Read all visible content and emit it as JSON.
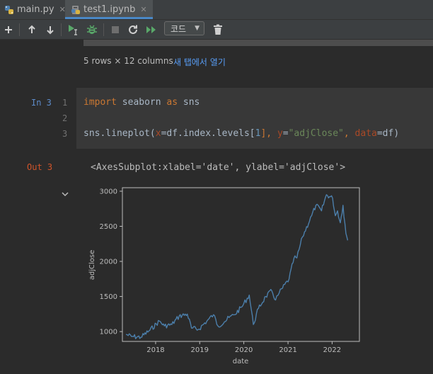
{
  "tabs": [
    {
      "label": "main.py",
      "icon": "python-file-icon",
      "active": false
    },
    {
      "label": "test1.ipynb",
      "icon": "notebook-file-icon",
      "active": true
    }
  ],
  "toolbar": {
    "cell_type": "코드"
  },
  "output_info": {
    "rows_text": "5 rows × 12 columns",
    "open_link": "새 탭에서 열기"
  },
  "cell": {
    "in_prompt": "In 3",
    "out_prompt": "Out 3",
    "line_numbers": [
      "1",
      "2",
      "3"
    ],
    "line1": {
      "t1": "import",
      "t2": " seaborn ",
      "t3": "as",
      "t4": " sns"
    },
    "line3": {
      "p1": "sns.lineplot(",
      "p2": "x",
      "p3": "=df.index.levels[",
      "p4": "1",
      "p5": "], ",
      "p6": "y",
      "p7": "=",
      "p8": "\"adjClose\"",
      "p9": ", ",
      "p10": "data",
      "p11": "=df)"
    },
    "output_text": "<AxesSubplot:xlabel='date', ylabel='adjClose'>"
  },
  "colors": {
    "line": "#4c7fab",
    "accent": "#4a88c7"
  },
  "chart_data": {
    "type": "line",
    "xlabel": "date",
    "ylabel": "adjClose",
    "x_ticks": [
      "2018",
      "2019",
      "2020",
      "2021",
      "2022"
    ],
    "y_ticks": [
      "1000",
      "1500",
      "2000",
      "2500",
      "3000"
    ],
    "xlim": [
      "2017-04-01",
      "2022-08-15"
    ],
    "ylim": [
      860,
      3050
    ],
    "grid": false,
    "series": [
      {
        "x": [
          "2017-05-01",
          "2017-06-15",
          "2017-09-01",
          "2017-11-15",
          "2018-02-01",
          "2018-03-15",
          "2018-05-15",
          "2018-07-15",
          "2018-09-20",
          "2018-10-25",
          "2018-12-20",
          "2019-03-01",
          "2019-04-25",
          "2019-06-01",
          "2019-07-25",
          "2019-09-01",
          "2019-10-15",
          "2019-12-15",
          "2020-02-15",
          "2020-03-20",
          "2020-05-01",
          "2020-07-01",
          "2020-08-20",
          "2020-09-20",
          "2020-10-20",
          "2021-01-10",
          "2021-02-20",
          "2021-03-15",
          "2021-05-01",
          "2021-07-15",
          "2021-08-20",
          "2021-10-05",
          "2021-11-15",
          "2022-01-05",
          "2022-01-28",
          "2022-02-15",
          "2022-03-10",
          "2022-04-01",
          "2022-04-25",
          "2022-05-10"
        ],
        "y": [
          960,
          930,
          920,
          1020,
          1150,
          1080,
          1100,
          1220,
          1250,
          1050,
          1030,
          1150,
          1240,
          1080,
          1140,
          1200,
          1240,
          1350,
          1520,
          1100,
          1330,
          1500,
          1580,
          1450,
          1550,
          1750,
          2050,
          2050,
          2350,
          2650,
          2800,
          2720,
          2950,
          2900,
          2650,
          2720,
          2550,
          2800,
          2400,
          2300
        ]
      }
    ]
  }
}
